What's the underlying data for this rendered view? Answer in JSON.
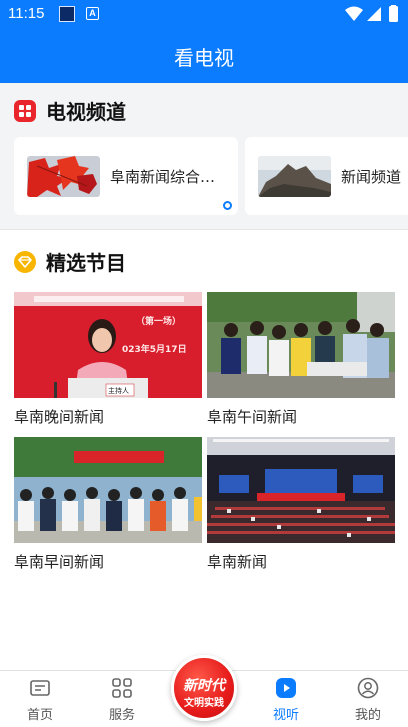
{
  "status_bar": {
    "time": "11:15",
    "mini_icon": "A",
    "battery_icon": "battery-icon",
    "signal_icon": "signal-icon",
    "wifi_icon": "wifi-icon"
  },
  "header": {
    "title": "看电视"
  },
  "tv_channels": {
    "title": "电视频道",
    "icon": "tv-channel-icon",
    "items": [
      {
        "label": "阜南新闻综合频道",
        "thumb": "red-maple-leaves-image"
      },
      {
        "label": "新闻频道",
        "thumb": "mountain-peak-image"
      }
    ]
  },
  "featured": {
    "title": "精选节目",
    "icon": "featured-gem-icon",
    "items": [
      {
        "label": "阜南晚间新闻",
        "thumb": "presenter-image",
        "overlay_sub": "（第一场）",
        "overlay_date": "023年5月17日",
        "overlay_sign": "主持人"
      },
      {
        "label": "阜南午间新闻",
        "thumb": "outdoor-crowd-image"
      },
      {
        "label": "阜南早间新闻",
        "thumb": "students-banner-image"
      },
      {
        "label": "阜南新闻",
        "thumb": "conference-hall-image"
      }
    ]
  },
  "bottom_nav": {
    "items": [
      {
        "label": "首页",
        "icon": "home-news-icon"
      },
      {
        "label": "服务",
        "icon": "grid-services-icon"
      },
      {
        "label": "视听",
        "icon": "play-icon",
        "active": true
      },
      {
        "label": "我的",
        "icon": "profile-icon"
      }
    ],
    "center": {
      "line1": "新时代",
      "line2": "文明实践"
    }
  },
  "colors": {
    "accent": "#0c7cff",
    "red": "#e8262b",
    "yellow": "#f7b500"
  }
}
